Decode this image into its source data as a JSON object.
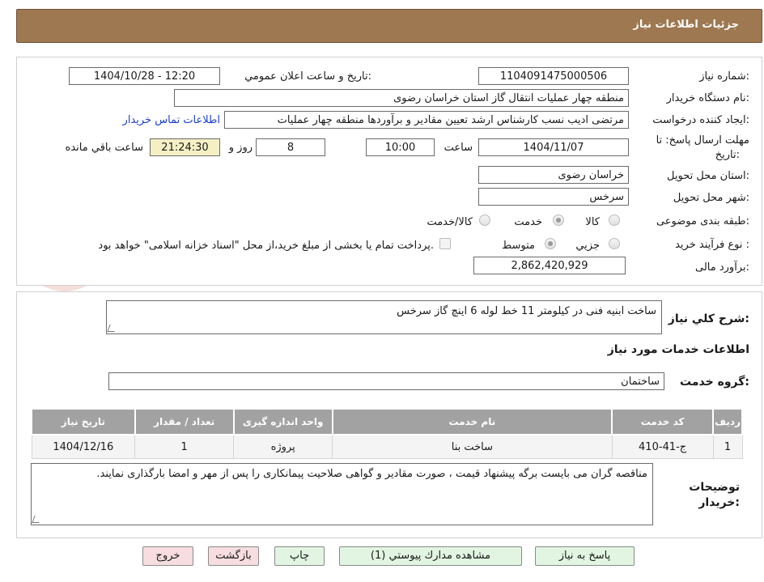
{
  "header": {
    "title": "جزئيات اطلاعات نياز"
  },
  "form": {
    "need_number_label": "شماره نياز:",
    "need_number": "1104091475000506",
    "announce_label": "تاريخ و ساعت اعلان عمومي:",
    "announce_value": "1404/10/28 - 12:20",
    "buyer_org_label": "نام دستگاه خريدار:",
    "buyer_org": "منطقه چهار عمليات انتقال گاز   استان خراسان رضوی",
    "requester_label": "ايجاد كننده درخواست:",
    "requester": "مرتضی ادیب نسب کارشناس ارشد تعيين مقادير و برآوردها منطقه چهار عمليات",
    "contact_link": "اطلاعات تماس خريدار",
    "deadline_label_1": "مهلت ارسال پاسخ: تا",
    "deadline_label_2": "تاريخ:",
    "deadline_date": "1404/11/07",
    "time_label": "ساعت",
    "deadline_time": "10:00",
    "days_value": "8",
    "days_label": "روز و",
    "remaining_time": "21:24:30",
    "remaining_label": "ساعت باقي مانده",
    "province_label": "استان محل تحويل:",
    "province": "خراسان رضوی",
    "city_label": "شهر محل تحويل:",
    "city": "سرخس",
    "category_label": "طبقه بندی موضوعی:",
    "category_options": [
      "كالا",
      "خدمت",
      "كالا/خدمت"
    ],
    "category_selected": "خدمت",
    "process_label": "نوع فرآيند خريد :",
    "process_options": [
      "جزيي",
      "متوسط"
    ],
    "process_selected": "متوسط",
    "payment_note": "پرداخت تمام يا بخشی از مبلغ خريد،از محل \"اسناد خزانه اسلامی\" خواهد بود.",
    "budget_label": "برآورد مالی:",
    "budget": "2,862,420,929"
  },
  "description": {
    "label": "شرح كلي نياز:",
    "value": "ساخت ابنیه فنی در کیلومتر 11 خط لوله 6 اینچ گاز سرخس"
  },
  "services": {
    "section_title": "اطلاعات خدمات مورد نياز",
    "group_label": "گروه خدمت:",
    "group_value": "ساختمان",
    "columns": [
      "رديف",
      "كد خدمت",
      "نام خدمت",
      "واحد اندازه گيری",
      "تعداد / مقدار",
      "تاريخ نياز"
    ],
    "rows": [
      [
        "1",
        "ج-41-410",
        "ساخت بنا",
        "پروژه",
        "1",
        "1404/12/16"
      ]
    ]
  },
  "buyer_notes": {
    "label_1": "توضيحات",
    "label_2": "خريدار:",
    "value": "مناقصه گران می بایست برگه پیشنهاد قیمت ، صورت مقادیر و گواهی صلاحیت پیمانکاری را پس از مهر و امضا بارگذاری نمایند."
  },
  "buttons": {
    "reply": "پاسخ به نياز",
    "view_docs": "مشاهده مدارك پيوستي (1)",
    "print": "چاپ",
    "back": "بازگشت",
    "exit": "خروج"
  },
  "colors": {
    "header_bg": "#9d7850",
    "link": "#1a3ecf",
    "table_header": "#a2a2a2",
    "highlight": "#f5f0c4",
    "button_green": "#e2f5e2",
    "button_pink": "#f7dde0"
  }
}
